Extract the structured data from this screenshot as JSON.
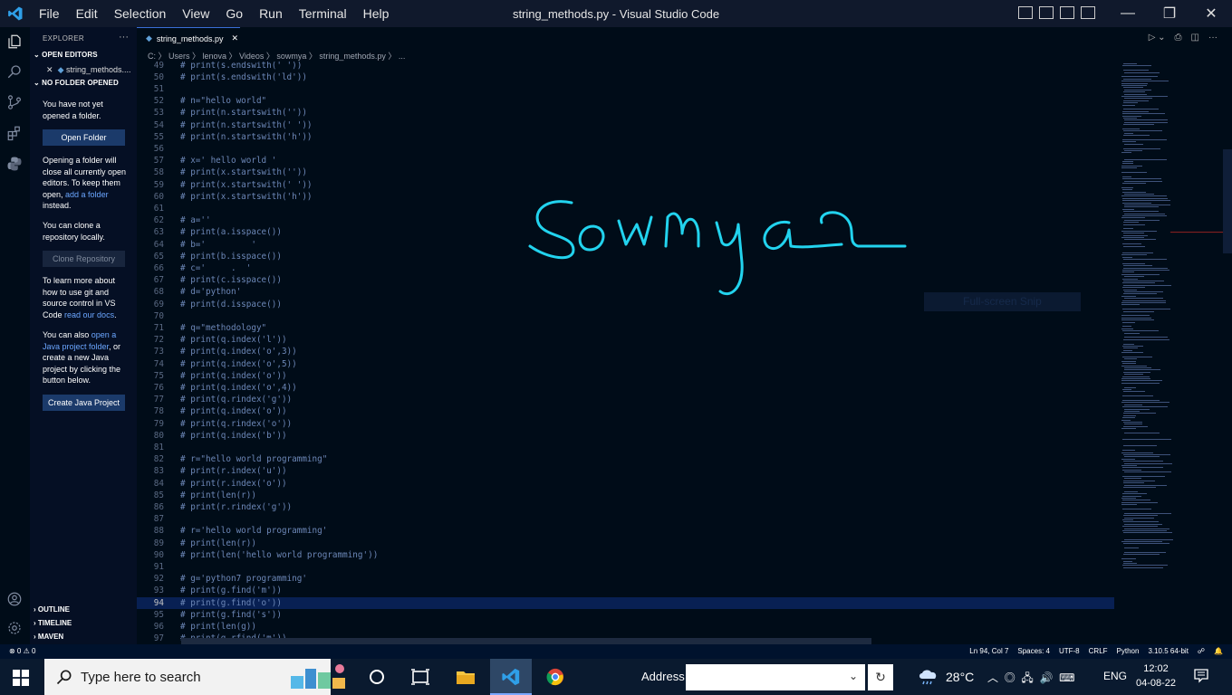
{
  "titlebar": {
    "menu": [
      "File",
      "Edit",
      "Selection",
      "View",
      "Go",
      "Run",
      "Terminal",
      "Help"
    ],
    "title": "string_methods.py - Visual Studio Code"
  },
  "sidebar": {
    "explorer_title": "EXPLORER",
    "open_editors": "OPEN EDITORS",
    "open_file": "string_methods....",
    "no_folder": "NO FOLDER OPENED",
    "msg1": "You have not yet opened a folder.",
    "open_folder_btn": "Open Folder",
    "msg2_a": "Opening a folder will close all currently open editors. To keep them open, ",
    "msg2_link": "add a folder",
    "msg2_b": " instead.",
    "msg3": "You can clone a repository locally.",
    "clone_btn": "Clone Repository",
    "msg4_a": "To learn more about how to use git and source control in VS Code ",
    "msg4_link": "read our docs",
    "msg4_b": ".",
    "msg5_a": "You can also ",
    "msg5_link": "open a Java project folder",
    "msg5_b": ", or create a new Java project by clicking the button below.",
    "java_btn": "Create Java Project",
    "outline": "OUTLINE",
    "timeline": "TIMELINE",
    "maven": "MAVEN"
  },
  "editor": {
    "tab_label": "string_methods.py",
    "breadcrumb": "C: 〉 Users 〉 lenova 〉 Videos 〉 sowmya 〉 string_methods.py 〉 ...",
    "current_line": 94,
    "lines": [
      {
        "n": 49,
        "t": "# print(s.endswith(' '))"
      },
      {
        "n": 50,
        "t": "# print(s.endswith('ld'))"
      },
      {
        "n": 51,
        "t": ""
      },
      {
        "n": 52,
        "t": "# n=\"hello world\""
      },
      {
        "n": 53,
        "t": "# print(n.startswith(''))"
      },
      {
        "n": 54,
        "t": "# print(n.startswith(' '))"
      },
      {
        "n": 55,
        "t": "# print(n.startswith('h'))"
      },
      {
        "n": 56,
        "t": ""
      },
      {
        "n": 57,
        "t": "# x=' hello world '"
      },
      {
        "n": 58,
        "t": "# print(x.startswith(''))"
      },
      {
        "n": 59,
        "t": "# print(x.startswith(' '))"
      },
      {
        "n": 60,
        "t": "# print(x.startswith('h'))"
      },
      {
        "n": 61,
        "t": ""
      },
      {
        "n": 62,
        "t": "# a=''"
      },
      {
        "n": 63,
        "t": "# print(a.isspace())"
      },
      {
        "n": 64,
        "t": "# b='         '"
      },
      {
        "n": 65,
        "t": "# print(b.isspace())"
      },
      {
        "n": 66,
        "t": "# c='     .  '"
      },
      {
        "n": 67,
        "t": "# print(c.isspace())"
      },
      {
        "n": 68,
        "t": "# d='python'"
      },
      {
        "n": 69,
        "t": "# print(d.isspace())"
      },
      {
        "n": 70,
        "t": ""
      },
      {
        "n": 71,
        "t": "# q=\"methodology\""
      },
      {
        "n": 72,
        "t": "# print(q.index('l'))"
      },
      {
        "n": 73,
        "t": "# print(q.index('o',3))"
      },
      {
        "n": 74,
        "t": "# print(q.index('o',5))"
      },
      {
        "n": 75,
        "t": "# print(q.index('o'))"
      },
      {
        "n": 76,
        "t": "# print(q.index('o',4))"
      },
      {
        "n": 77,
        "t": "# print(q.rindex('g'))"
      },
      {
        "n": 78,
        "t": "# print(q.index('o'))"
      },
      {
        "n": 79,
        "t": "# print(q.rindex('o'))"
      },
      {
        "n": 80,
        "t": "# print(q.index('b'))"
      },
      {
        "n": 81,
        "t": ""
      },
      {
        "n": 82,
        "t": "# r=\"hello world programming\""
      },
      {
        "n": 83,
        "t": "# print(r.index('u'))"
      },
      {
        "n": 84,
        "t": "# print(r.index('o'))"
      },
      {
        "n": 85,
        "t": "# print(len(r))"
      },
      {
        "n": 86,
        "t": "# print(r.rindex('g'))"
      },
      {
        "n": 87,
        "t": ""
      },
      {
        "n": 88,
        "t": "# r='hello world programming'"
      },
      {
        "n": 89,
        "t": "# print(len(r))"
      },
      {
        "n": 90,
        "t": "# print(len('hello world programming'))"
      },
      {
        "n": 91,
        "t": ""
      },
      {
        "n": 92,
        "t": "# g='python7 programming'"
      },
      {
        "n": 93,
        "t": "# print(g.find('m'))"
      },
      {
        "n": 94,
        "t": "# print(g.find('o'))"
      },
      {
        "n": 95,
        "t": "# print(g.find('s'))"
      },
      {
        "n": 96,
        "t": "# print(len(g))"
      },
      {
        "n": 97,
        "t": "# print(g.rfind('m'))"
      }
    ]
  },
  "overlay": {
    "snip_label": "Full-screen Snip",
    "handwriting": "sowmya"
  },
  "status": {
    "left": "⊗ 0 ⚠ 0",
    "ln_col": "Ln 94, Col 7",
    "spaces": "Spaces: 4",
    "encoding": "UTF-8",
    "eol": "CRLF",
    "language": "Python",
    "interpreter": "3.10.5 64-bit"
  },
  "taskbar": {
    "search_placeholder": "Type here to search",
    "address_label": "Address",
    "temperature": "28°C",
    "language": "ENG",
    "time": "12:02",
    "date": "04-08-22"
  },
  "colors": {
    "accent": "#3a6fd6",
    "handwriting": "#22d3ee",
    "editor_bg": "#000c18"
  }
}
